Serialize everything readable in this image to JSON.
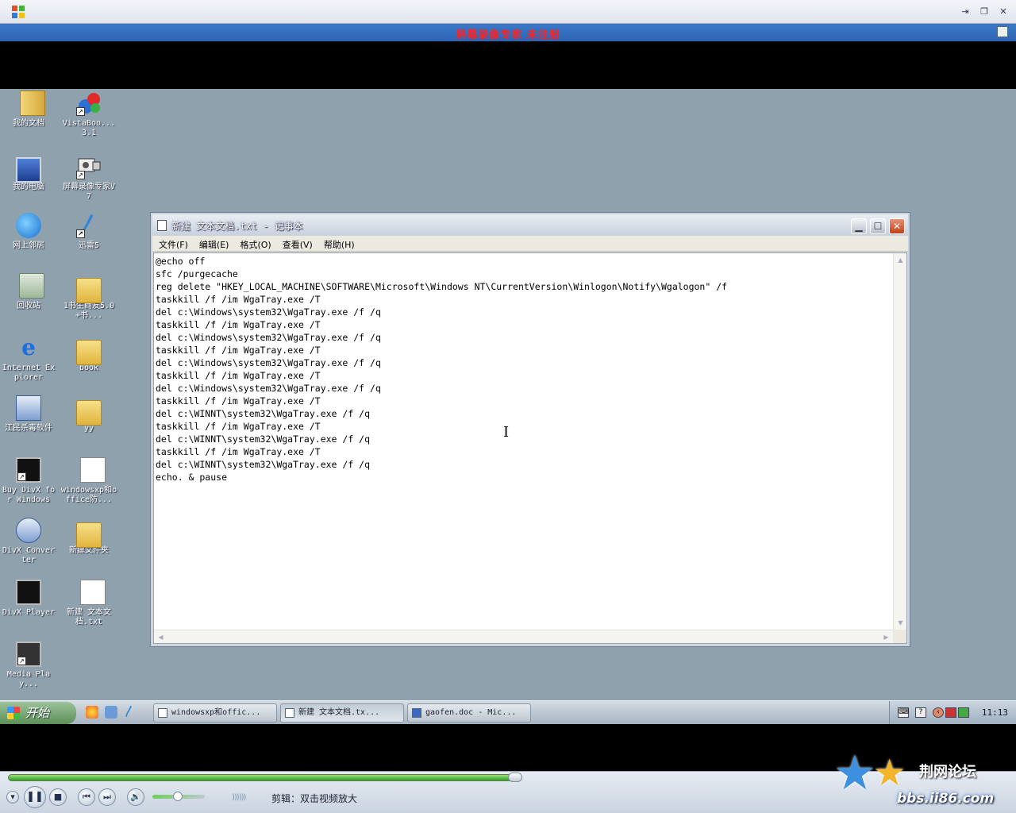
{
  "player": {
    "watermark": "屏幕录像专家 未注册",
    "status_text": "剪辑：双击视频放大",
    "bars": "))))))",
    "progress": 0.98
  },
  "desktop_icons": [
    {
      "label": "我的文档",
      "icon": "my-documents-icon"
    },
    {
      "label": "VistaBoo... 3.1",
      "icon": "vistaboot-icon"
    },
    {
      "label": "我的电脑",
      "icon": "my-computer-icon"
    },
    {
      "label": "屏幕录像专家V7",
      "icon": "screen-recorder-icon"
    },
    {
      "label": "网上邻居",
      "icon": "network-places-icon"
    },
    {
      "label": "迅雷5",
      "icon": "thunder-icon"
    },
    {
      "label": "回收站",
      "icon": "recycle-bin-icon"
    },
    {
      "label": "1书生商友5.0+书...",
      "icon": "folder-icon"
    },
    {
      "label": "Internet Explorer",
      "icon": "internet-explorer-icon"
    },
    {
      "label": "book",
      "icon": "folder-icon"
    },
    {
      "label": "江民杀毒软件",
      "icon": "antivirus-icon"
    },
    {
      "label": "yy",
      "icon": "folder-icon"
    },
    {
      "label": "Buy DivX for Windows",
      "icon": "divx-icon"
    },
    {
      "label": "windowsxp和office防...",
      "icon": "text-file-icon"
    },
    {
      "label": "DivX Converter",
      "icon": "divx-converter-icon"
    },
    {
      "label": "新建文件夹",
      "icon": "folder-icon"
    },
    {
      "label": "DivX Player",
      "icon": "divx-player-icon"
    },
    {
      "label": "新建 文本文档.txt",
      "icon": "text-file-icon"
    },
    {
      "label": "Media Play...",
      "icon": "media-player-icon"
    }
  ],
  "notepad": {
    "title": "新建 文本文档.txt - 记事本",
    "menu": [
      "文件(F)",
      "编辑(E)",
      "格式(O)",
      "查看(V)",
      "帮助(H)"
    ],
    "lines": [
      "@echo off",
      "sfc /purgecache",
      "reg delete \"HKEY_LOCAL_MACHINE\\SOFTWARE\\Microsoft\\Windows NT\\CurrentVersion\\Winlogon\\Notify\\Wgalogon\" /f",
      "taskkill /f /im WgaTray.exe /T",
      "del c:\\Windows\\system32\\WgaTray.exe /f /q",
      "taskkill /f /im WgaTray.exe /T",
      "del c:\\Windows\\system32\\WgaTray.exe /f /q",
      "taskkill /f /im WgaTray.exe /T",
      "del c:\\Windows\\system32\\WgaTray.exe /f /q",
      "taskkill /f /im WgaTray.exe /T",
      "del c:\\Windows\\system32\\WgaTray.exe /f /q",
      "taskkill /f /im WgaTray.exe /T",
      "del c:\\WINNT\\system32\\WgaTray.exe /f /q",
      "taskkill /f /im WgaTray.exe /T",
      "del c:\\WINNT\\system32\\WgaTray.exe /f /q",
      "taskkill /f /im WgaTray.exe /T",
      "del c:\\WINNT\\system32\\WgaTray.exe /f /q",
      "echo. & pause"
    ]
  },
  "taskbar": {
    "start_label": "开始",
    "items": [
      "windowsxp和offic...",
      "新建 文本文档.tx...",
      "gaofen.doc - Mic..."
    ],
    "clock": "11:13"
  },
  "forum": {
    "name": "荆网论坛",
    "url": "bbs.ii86.com"
  }
}
